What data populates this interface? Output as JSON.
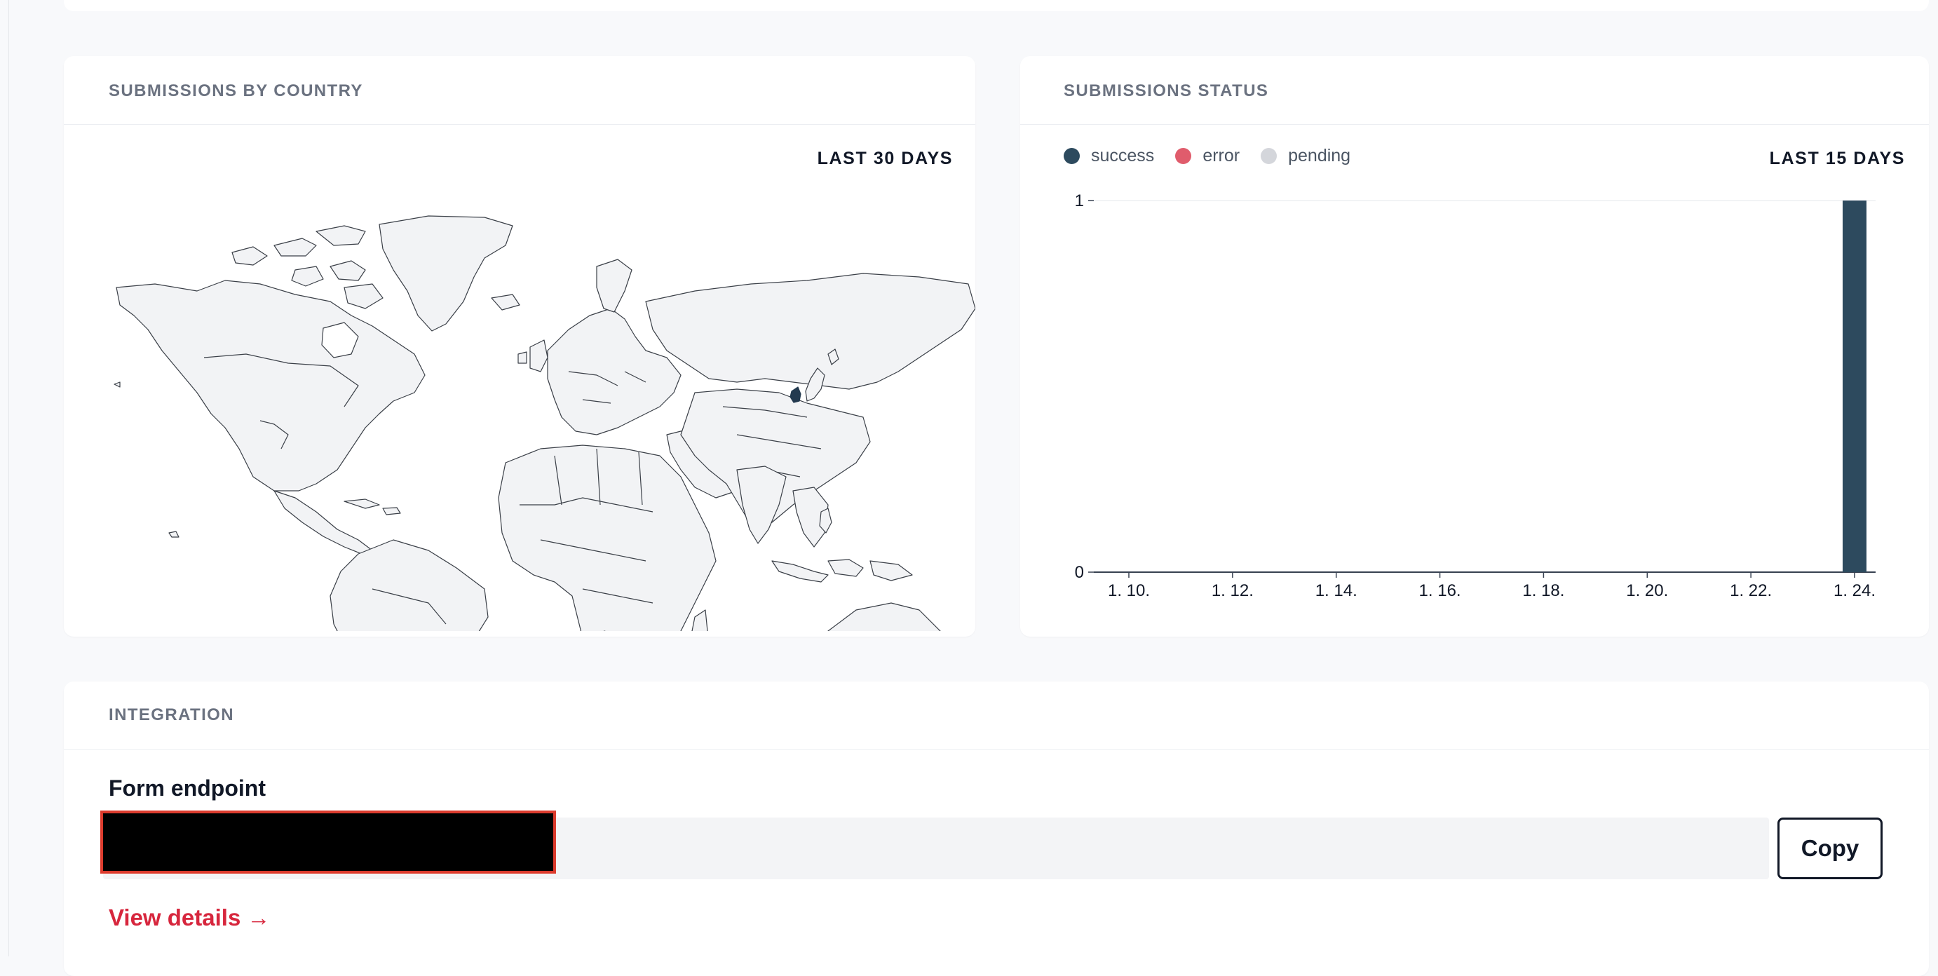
{
  "map_card": {
    "title": "SUBMISSIONS BY COUNTRY",
    "range": "LAST 30 DAYS",
    "highlight_color": "#233a4f",
    "land_color": "#f2f3f5",
    "border_color": "#3a3f47"
  },
  "status_card": {
    "title": "SUBMISSIONS STATUS",
    "range": "LAST 15 DAYS",
    "legend": [
      {
        "label": "success",
        "color": "#2d4a5e"
      },
      {
        "label": "error",
        "color": "#e05c6c"
      },
      {
        "label": "pending",
        "color": "#d4d6db"
      }
    ]
  },
  "chart_data": {
    "type": "bar",
    "categories": [
      "1. 10.",
      "1. 11.",
      "1. 12.",
      "1. 13.",
      "1. 14.",
      "1. 15.",
      "1. 16.",
      "1. 17.",
      "1. 18.",
      "1. 19.",
      "1. 20.",
      "1. 21.",
      "1. 22.",
      "1. 23.",
      "1. 24."
    ],
    "tick_labels": [
      "1. 10.",
      "1. 12.",
      "1. 14.",
      "1. 16.",
      "1. 18.",
      "1. 20.",
      "1. 22.",
      "1. 24."
    ],
    "series": [
      {
        "name": "success",
        "values": [
          0,
          0,
          0,
          0,
          0,
          0,
          0,
          0,
          0,
          0,
          0,
          0,
          0,
          0,
          1
        ]
      },
      {
        "name": "error",
        "values": [
          0,
          0,
          0,
          0,
          0,
          0,
          0,
          0,
          0,
          0,
          0,
          0,
          0,
          0,
          0
        ]
      },
      {
        "name": "pending",
        "values": [
          0,
          0,
          0,
          0,
          0,
          0,
          0,
          0,
          0,
          0,
          0,
          0,
          0,
          0,
          0
        ]
      }
    ],
    "yticks": [
      "0",
      "1"
    ],
    "ylim": [
      0,
      1
    ],
    "legend": "top-left"
  },
  "integration": {
    "title": "INTEGRATION",
    "field_label": "Form endpoint",
    "copy_label": "Copy",
    "view_details_label": "View details →"
  }
}
